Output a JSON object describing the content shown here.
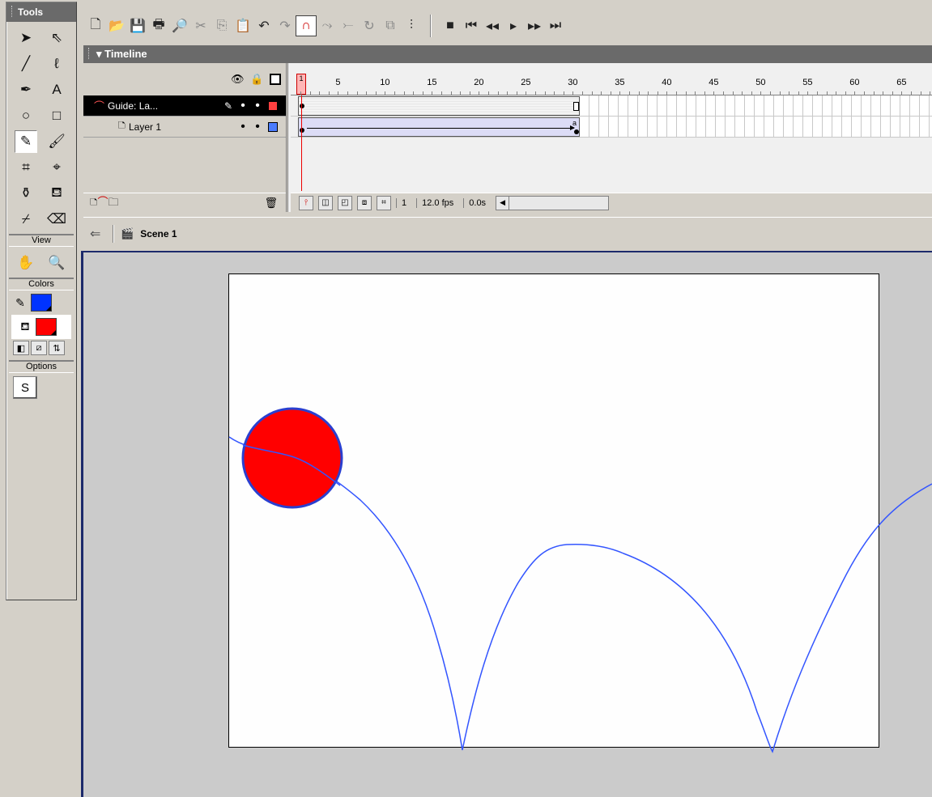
{
  "tools_panel": {
    "title": "Tools",
    "tools": [
      {
        "name": "arrow-tool",
        "glyph": "➤"
      },
      {
        "name": "subselect-tool",
        "glyph": "⇖"
      },
      {
        "name": "line-tool",
        "glyph": "╱"
      },
      {
        "name": "lasso-tool",
        "glyph": "ℓ"
      },
      {
        "name": "pen-tool",
        "glyph": "✒"
      },
      {
        "name": "text-tool",
        "glyph": "A"
      },
      {
        "name": "oval-tool",
        "glyph": "○"
      },
      {
        "name": "rectangle-tool",
        "glyph": "□"
      },
      {
        "name": "pencil-tool",
        "glyph": "✎"
      },
      {
        "name": "brush-tool",
        "glyph": "🖌"
      },
      {
        "name": "free-transform-tool",
        "glyph": "⌗"
      },
      {
        "name": "fill-transform-tool",
        "glyph": "⌖"
      },
      {
        "name": "ink-bottle-tool",
        "glyph": "⚱"
      },
      {
        "name": "paint-bucket-tool",
        "glyph": "⛾"
      },
      {
        "name": "eyedropper-tool",
        "glyph": "⌿"
      },
      {
        "name": "eraser-tool",
        "glyph": "⌫"
      }
    ],
    "view_label": "View",
    "view_tools": [
      {
        "name": "hand-tool",
        "glyph": "✋"
      },
      {
        "name": "zoom-tool",
        "glyph": "🔍"
      }
    ],
    "colors_label": "Colors",
    "stroke_color": "#0033ff",
    "fill_color": "#ff0000",
    "options_label": "Options",
    "option_glyph": "S"
  },
  "toolbar": {
    "icons": [
      "new-file-icon",
      "open-file-icon",
      "save-icon",
      "print-icon",
      "print-preview-icon",
      "cut-icon",
      "copy-icon",
      "paste-icon",
      "undo-icon",
      "redo-icon",
      "snap-magnet-icon",
      "smooth-icon",
      "straighten-icon",
      "rotate-icon",
      "scale-icon",
      "align-icon"
    ],
    "playback": [
      "stop-icon",
      "rewind-icon",
      "step-back-icon",
      "play-icon",
      "step-forward-icon",
      "go-to-end-icon"
    ]
  },
  "timeline": {
    "title": "Timeline",
    "ruler_labels": [
      "1",
      "5",
      "10",
      "15",
      "20",
      "25",
      "30",
      "35",
      "40",
      "45",
      "50",
      "55",
      "60",
      "65"
    ],
    "layers": [
      {
        "name": "Guide: La...",
        "selected": true,
        "color": "#ff4040"
      },
      {
        "name": "Layer 1",
        "selected": false,
        "color": "#4a7cff"
      }
    ],
    "status": {
      "current_frame": "1",
      "fps": "12.0 fps",
      "elapsed": "0.0s"
    }
  },
  "scene_bar": {
    "scene_name": "Scene 1"
  },
  "stage": {
    "background": "#fefefe",
    "ball_fill": "#ff0000",
    "ball_stroke": "#2a3fd0",
    "guide_color": "#3355ff"
  }
}
